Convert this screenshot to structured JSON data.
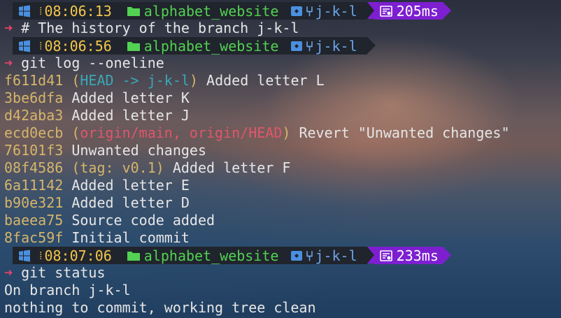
{
  "colors": {
    "prompt_bg": "#20242c",
    "duration_bg": "#7d1fd1",
    "time": "#f3c64b",
    "directory": "#52d152",
    "branch": "#6aa5e8",
    "prompt_arrow": "#e5446a",
    "hash": "#d6b56a",
    "ref_head": "#3aa8b6",
    "ref_origin": "#e0566b"
  },
  "icons": {
    "os": "windows-icon",
    "folder": "folder-icon",
    "git": "git-icon",
    "branch": "branch-icon",
    "duration": "stopwatch-icon"
  },
  "prompt_symbol": "➜",
  "prompts": [
    {
      "time": "08:06:13",
      "directory": "alphabet_website",
      "branch": "j-k-l",
      "duration": "205ms"
    },
    {
      "time": "08:06:56",
      "directory": "alphabet_website",
      "branch": "j-k-l",
      "duration": ""
    },
    {
      "time": "08:07:06",
      "directory": "alphabet_website",
      "branch": "j-k-l",
      "duration": "233ms"
    }
  ],
  "commands": [
    "# The history of the branch j-k-l",
    "git log --oneline",
    "git status"
  ],
  "log": [
    {
      "hash": "f611d41",
      "ref_open": "(",
      "ref_head": "HEAD -> j-k-l",
      "ref_close": ")",
      "message": "Added letter L"
    },
    {
      "hash": "3be6dfa",
      "message": "Added letter K"
    },
    {
      "hash": "d42aba3",
      "message": "Added letter J"
    },
    {
      "hash": "ecd0ecb",
      "ref_open": "(",
      "ref_origin": "origin/main, origin/HEAD",
      "ref_close": ")",
      "message": "Revert \"Unwanted changes\""
    },
    {
      "hash": "76101f3",
      "message": "Unwanted changes"
    },
    {
      "hash": "08f4586",
      "ref_tag": "(tag: v0.1)",
      "message": "Added letter F"
    },
    {
      "hash": "6a11142",
      "message": "Added letter E"
    },
    {
      "hash": "b90e321",
      "message": "Added letter D"
    },
    {
      "hash": "baeea75",
      "message": "Source code added"
    },
    {
      "hash": "8fac59f",
      "message": "Initial commit"
    }
  ],
  "status_output": [
    "On branch j-k-l",
    "nothing to commit, working tree clean"
  ]
}
